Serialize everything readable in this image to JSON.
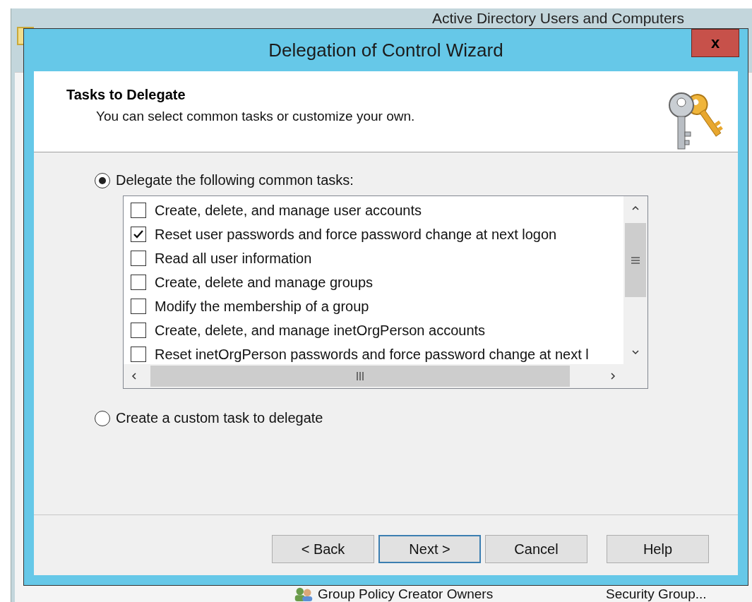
{
  "background_window": {
    "title": "Active Directory Users and Computers",
    "visible_row": {
      "name": "Group Policy Creator Owners",
      "type": "Security Group..."
    }
  },
  "dialog": {
    "title": "Delegation of Control Wizard",
    "close_label": "x",
    "header": {
      "title": "Tasks to Delegate",
      "subtitle": "You can select common tasks or customize your own."
    },
    "options": [
      {
        "label": "Delegate the following common tasks:",
        "selected": true
      },
      {
        "label": "Create a custom task to delegate",
        "selected": false
      }
    ],
    "tasks": [
      {
        "label": "Create, delete, and manage user accounts",
        "checked": false
      },
      {
        "label": "Reset user passwords and force password change at next logon",
        "checked": true
      },
      {
        "label": "Read all user information",
        "checked": false
      },
      {
        "label": "Create, delete and manage groups",
        "checked": false
      },
      {
        "label": "Modify the membership of a group",
        "checked": false
      },
      {
        "label": "Create, delete, and manage inetOrgPerson accounts",
        "checked": false
      },
      {
        "label": "Reset inetOrgPerson passwords and force password change at next l",
        "checked": false
      }
    ],
    "buttons": [
      {
        "label": "< Back",
        "default": false
      },
      {
        "label": "Next >",
        "default": true
      },
      {
        "label": "Cancel",
        "default": false
      },
      {
        "label": "Help",
        "default": false
      }
    ]
  }
}
